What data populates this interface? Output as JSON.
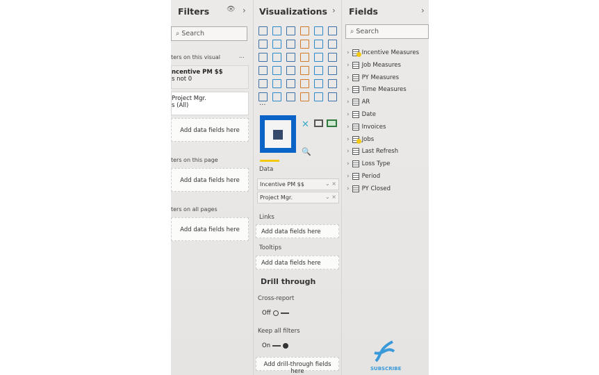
{
  "filters": {
    "title": "Filters",
    "search_placeholder": "Search",
    "visual_header": "ters on this visual",
    "more": "...",
    "cards": [
      {
        "name": "ncentive PM $$",
        "value": "s not 0"
      },
      {
        "name": "Project Mgr.",
        "value": "s (All)"
      }
    ],
    "add_fields": "Add data fields here",
    "page_header": "ters on this page",
    "all_header": "ters on all pages"
  },
  "viz": {
    "title": "Visualizations",
    "more": "...",
    "icons": [
      "stacked-bar",
      "stacked-column",
      "clustered-bar",
      "clustered-column",
      "100-bar",
      "100-column",
      "line",
      "area",
      "stacked-area",
      "line-column",
      "line-clustered",
      "ribbon",
      "waterfall",
      "funnel",
      "scatter",
      "pie",
      "donut",
      "treemap",
      "map",
      "filled-map",
      "shape-map",
      "azure-map",
      "gauge",
      "card",
      "multirow-card",
      "kpi",
      "slicer",
      "table",
      "matrix",
      "r-visual",
      "python-visual",
      "key-influencers",
      "decomposition-tree",
      "qa",
      "smart-narrative",
      "paginated"
    ],
    "data_label": "Data",
    "wells": [
      "Incentive PM $$",
      "Project Mgr."
    ],
    "links": "Links",
    "tooltips": "Tooltips",
    "add_fields": "Add data fields here",
    "drill": "Drill through",
    "cross_report": "Cross-report",
    "off": "Off",
    "keep_filters": "Keep all filters",
    "on": "On",
    "add_drill": "Add drill-through fields here"
  },
  "fields": {
    "title": "Fields",
    "search_placeholder": "Search",
    "items": [
      "Incentive Measures",
      "Job Measures",
      "PY Measures",
      "Time Measures",
      "AR",
      "Date",
      "Invoices",
      "Jobs",
      "Last Refresh",
      "Loss Type",
      "Period",
      "PY Closed"
    ]
  },
  "logo": {
    "text": "SUBSCRIBE"
  },
  "colors": {
    "accent": "#0a64c8",
    "highlight": "#f2c811"
  }
}
